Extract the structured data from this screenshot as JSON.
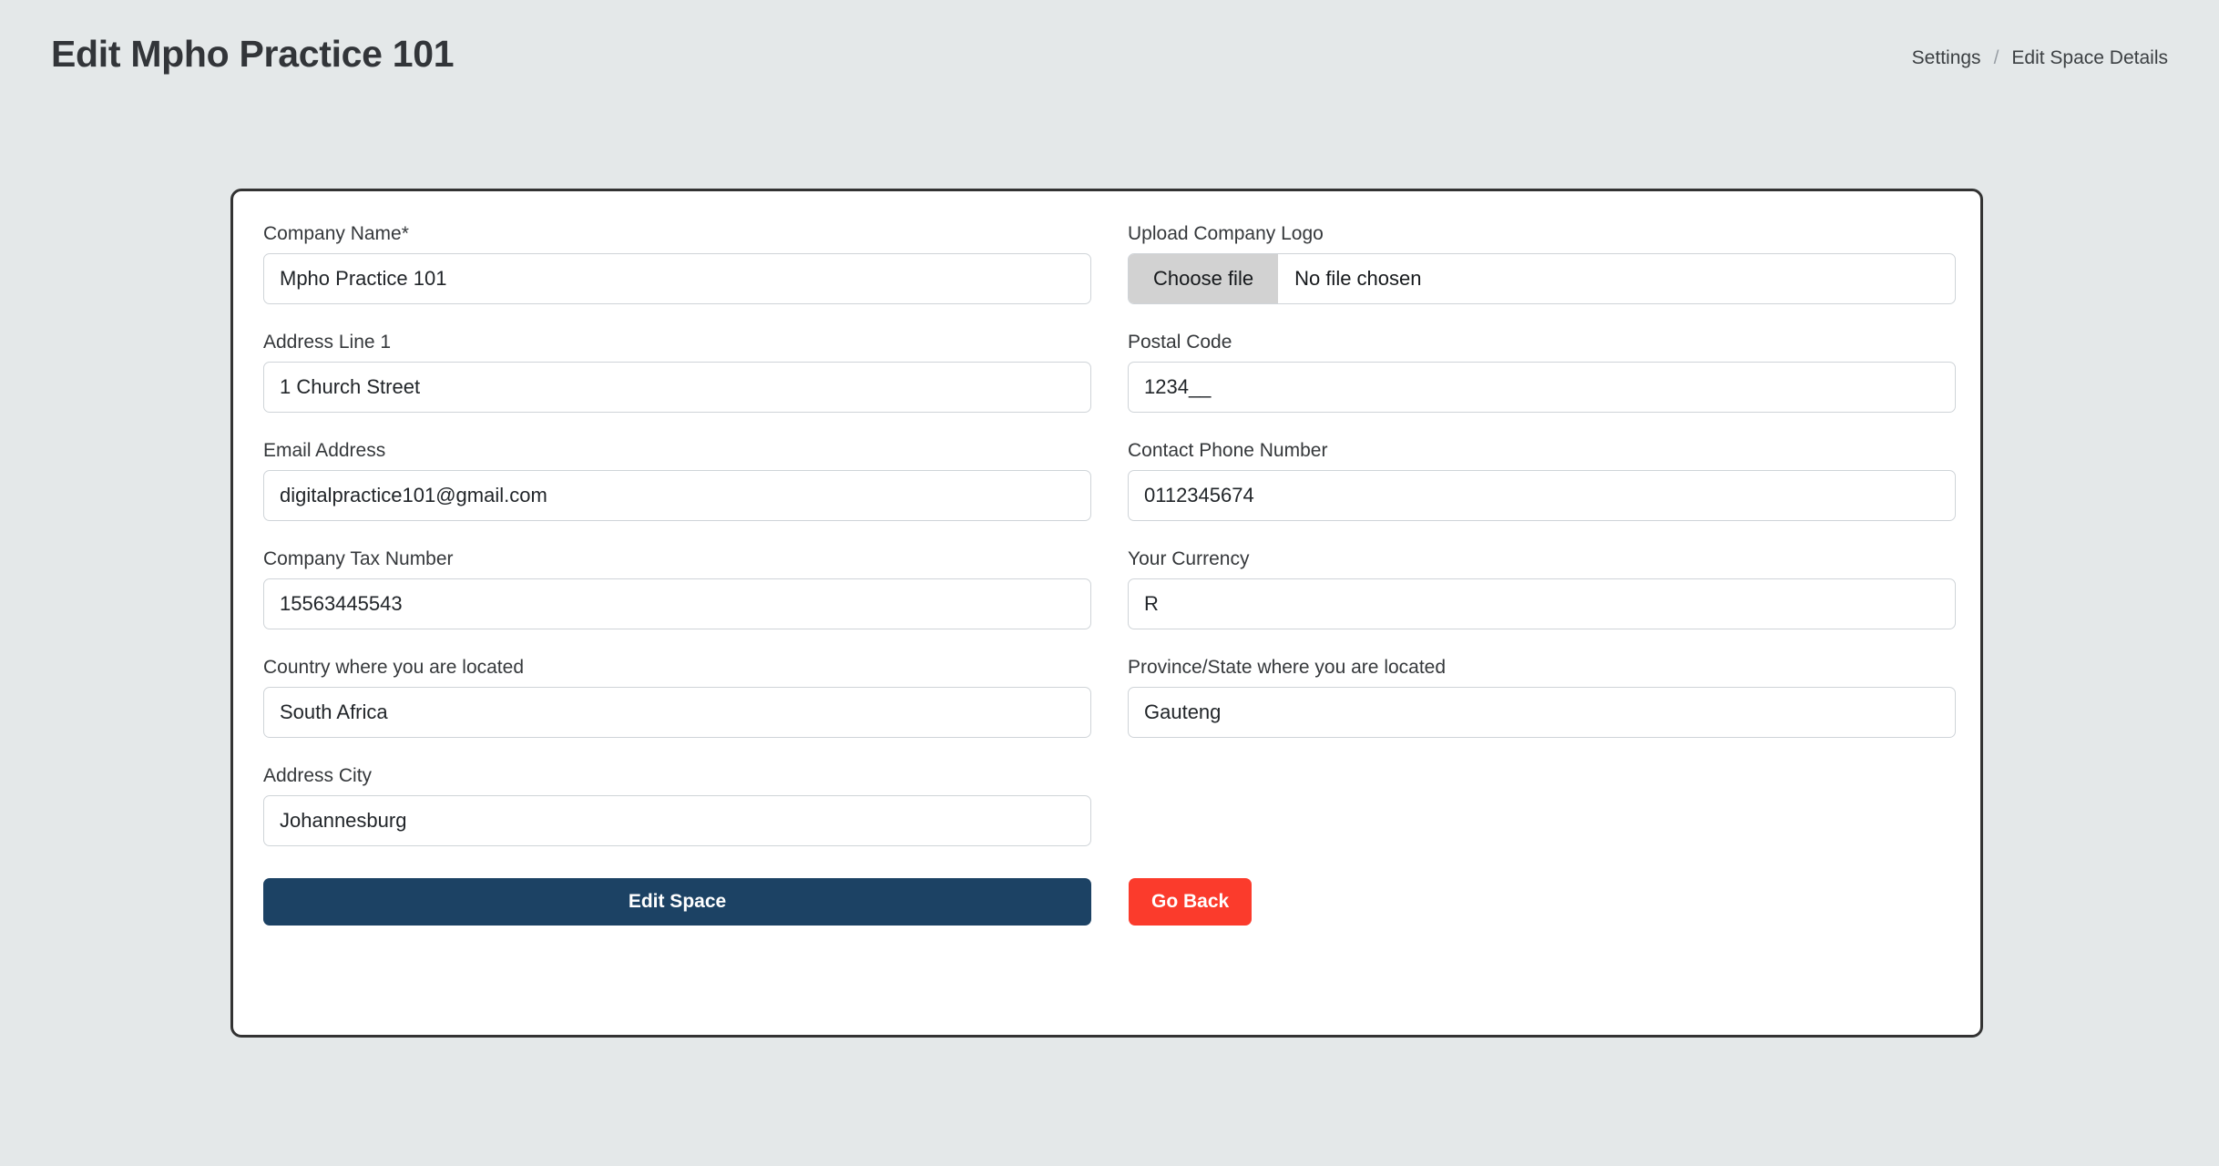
{
  "header": {
    "title": "Edit Mpho Practice 101",
    "breadcrumb": {
      "parent": "Settings",
      "separator": "/",
      "current": "Edit Space Details"
    }
  },
  "form": {
    "fields": {
      "company_name": {
        "label": "Company Name*",
        "value": "Mpho Practice 101"
      },
      "company_logo": {
        "label": "Upload Company Logo",
        "choose_button": "Choose file",
        "status": "No file chosen"
      },
      "address_line_1": {
        "label": "Address Line 1",
        "value": "1 Church Street"
      },
      "postal_code": {
        "label": "Postal Code",
        "value": "1234__"
      },
      "email_address": {
        "label": "Email Address",
        "value": "digitalpractice101@gmail.com"
      },
      "contact_phone_number": {
        "label": "Contact Phone Number",
        "value": "0112345674"
      },
      "company_tax_number": {
        "label": "Company Tax Number",
        "value": "15563445543"
      },
      "currency": {
        "label": "Your Currency",
        "value": "R"
      },
      "country": {
        "label": "Country where you are located",
        "value": "South Africa"
      },
      "province": {
        "label": "Province/State where you are located",
        "value": "Gauteng"
      },
      "address_city": {
        "label": "Address City",
        "value": "Johannesburg"
      }
    },
    "actions": {
      "submit_label": "Edit Space",
      "back_label": "Go Back"
    }
  },
  "colors": {
    "page_background": "#e4e8e9",
    "card_border": "#333333",
    "primary_button": "#1c4264",
    "danger_button": "#fb3b2c",
    "input_border": "#cfd4d8",
    "file_button_background": "#d2d2d2"
  }
}
